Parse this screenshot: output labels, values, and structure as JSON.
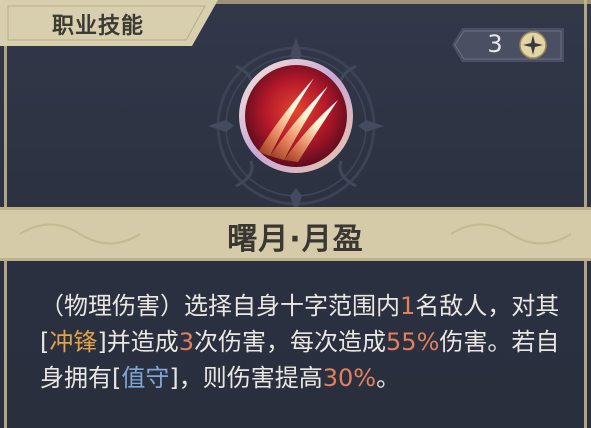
{
  "header": {
    "tab_label": "职业技能"
  },
  "counter": {
    "value": "3",
    "icon": "star-icon"
  },
  "skill": {
    "icon": "claw-slash-icon",
    "name": "曙月·月盈"
  },
  "description": {
    "p1": "（物理伤害）选择自身十字范围内",
    "n1": "1",
    "p2": "名敌人，对其[",
    "k1": "冲锋",
    "p3": "]并造成",
    "n2": "3",
    "p4": "次伤害，每次造成",
    "n3": "55%",
    "p5": "伤害。若自身拥有[",
    "k2": "值守",
    "p6": "]，则伤害提高",
    "n4": "30%",
    "p7": "。"
  },
  "colors": {
    "panel_bg": "#2c3140",
    "gold_trim": "#c9b98c",
    "number_highlight": "#e0805f",
    "keyword_gold": "#e0a24a",
    "keyword_blue": "#7fa6d6",
    "text": "#e9e7e2"
  }
}
